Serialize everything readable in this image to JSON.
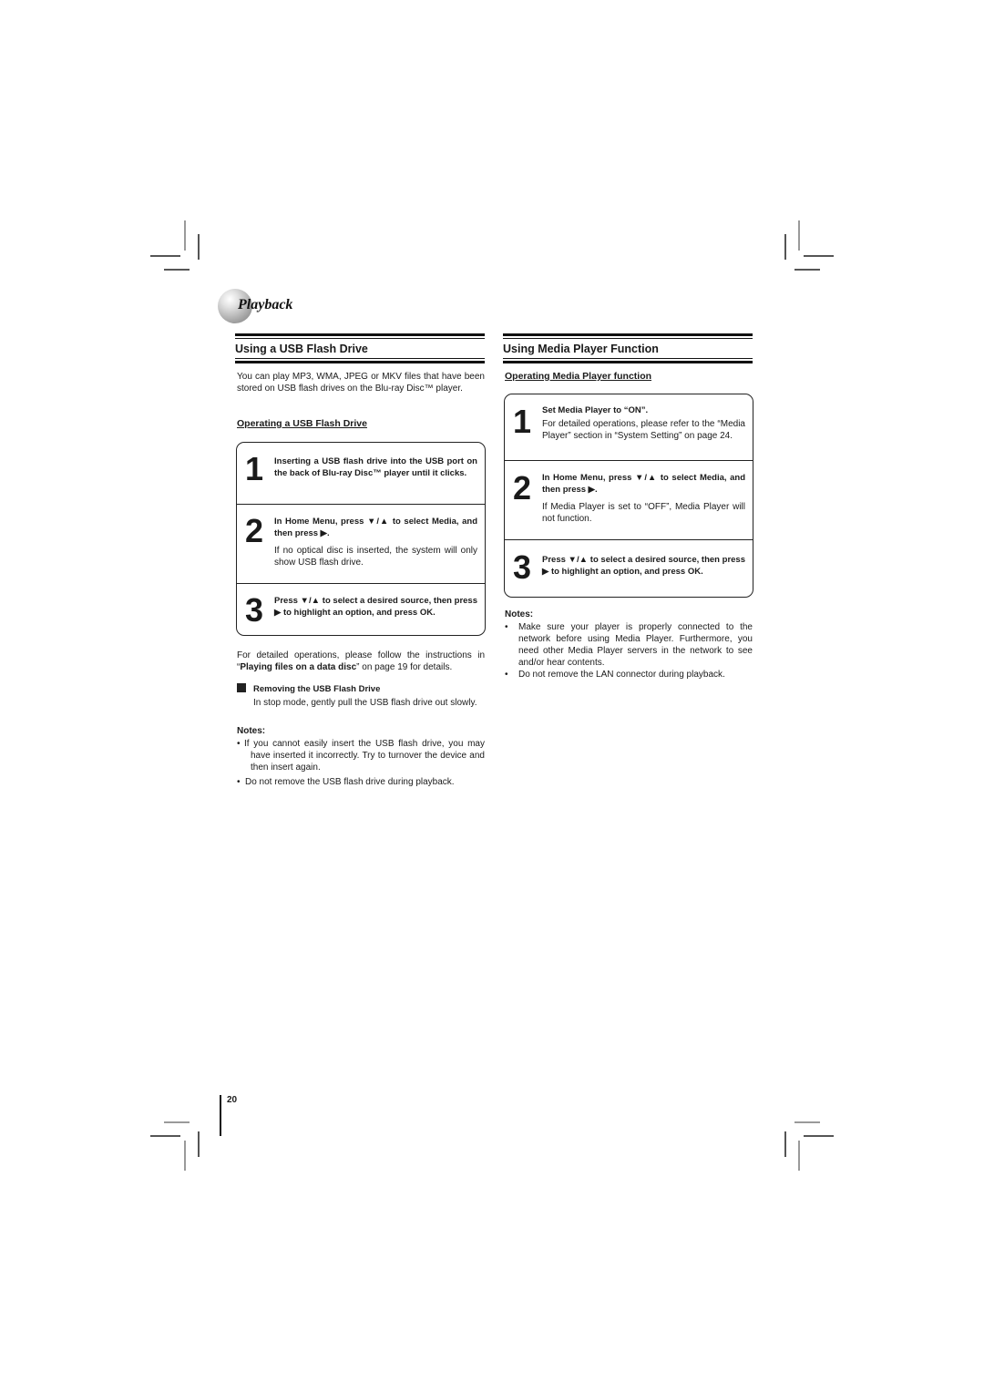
{
  "header": {
    "chapter_title": "Playback"
  },
  "left": {
    "section_title": "Using a USB Flash Drive",
    "intro": "You can play MP3, WMA, JPEG or MKV files that have been stored on USB flash drives on the Blu-ray Disc™ player.",
    "subheading": "Operating a USB Flash Drive",
    "steps": [
      {
        "number": "1",
        "title": "Inserting a USB flash drive into the USB port on the back of Blu-ray Disc™ player until it clicks.",
        "desc": ""
      },
      {
        "number": "2",
        "title": "In Home Menu, press ▼/▲ to select Media, and then press ▶.",
        "desc": "If no optical disc is inserted, the system will only show USB flash drive."
      },
      {
        "number": "3",
        "title": "Press ▼/▲ to select a desired source, then press ▶ to highlight an option, and press OK.",
        "desc": ""
      }
    ],
    "detail_pre": "For detailed operations, please follow the instructions in “",
    "detail_bold": "Playing files on a data disc",
    "detail_post": "” on page 19 for details.",
    "removing_heading": "Removing the USB Flash Drive",
    "removing_text": "In stop mode, gently pull the USB flash drive out slowly.",
    "notes_label": "Notes:",
    "notes": [
      "If you cannot easily insert the USB flash drive, you may have inserted it incorrectly. Try to turnover the device and then insert again.",
      "Do not remove the USB flash drive during playback."
    ]
  },
  "right": {
    "section_title": "Using Media Player Function",
    "subheading": "Operating Media Player function",
    "steps": [
      {
        "number": "1",
        "title": "Set Media Player to “ON”.",
        "desc": "For detailed operations, please refer to the “Media Player” section in “System Setting” on page 24."
      },
      {
        "number": "2",
        "title": "In Home Menu, press ▼/▲ to select Media, and then press ▶.",
        "desc": "If Media Player is set to “OFF”, Media Player will not function."
      },
      {
        "number": "3",
        "title": "Press ▼/▲ to select a desired source, then press ▶ to highlight an option, and press OK.",
        "desc": ""
      }
    ],
    "notes_label": "Notes:",
    "notes": [
      "Make sure your player is properly connected to the network before using Media Player. Furthermore, you need other Media Player servers in the network to see and/or hear contents.",
      "Do not remove the LAN connector during playback."
    ]
  },
  "footer": {
    "page_number": "20"
  }
}
